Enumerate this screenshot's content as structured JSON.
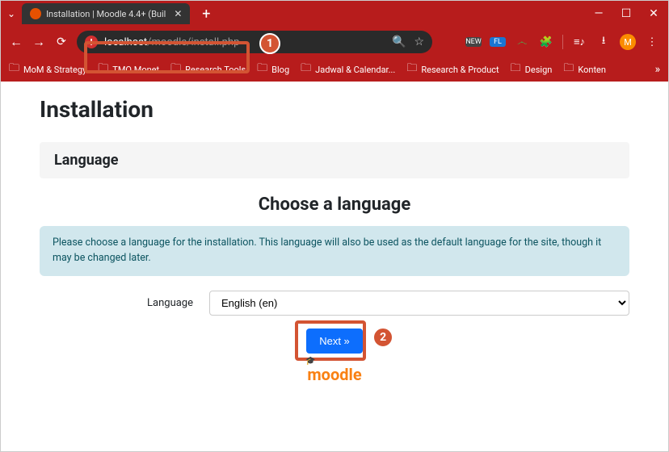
{
  "tab": {
    "title": "Installation | Moodle 4.4+ (Buil"
  },
  "url": {
    "host": "localhost",
    "path": "/moodle/install.php"
  },
  "bookmarks": [
    "MoM & Strategy",
    "TMO Monet",
    "Research Tools",
    "Blog",
    "Jadwal & Calendar...",
    "Research & Product",
    "Design",
    "Konten"
  ],
  "toolbar": {
    "new_badge": "NEW",
    "avatar_letter": "M"
  },
  "page": {
    "heading": "Installation",
    "section_title": "Language",
    "choose_title": "Choose a language",
    "info": "Please choose a language for the installation. This language will also be used as the default language for the site, though it may be changed later.",
    "field_label": "Language",
    "selected_option": "English (en)",
    "next_label": "Next »",
    "logo_text": "moodle"
  },
  "callouts": {
    "one": "1",
    "two": "2"
  }
}
